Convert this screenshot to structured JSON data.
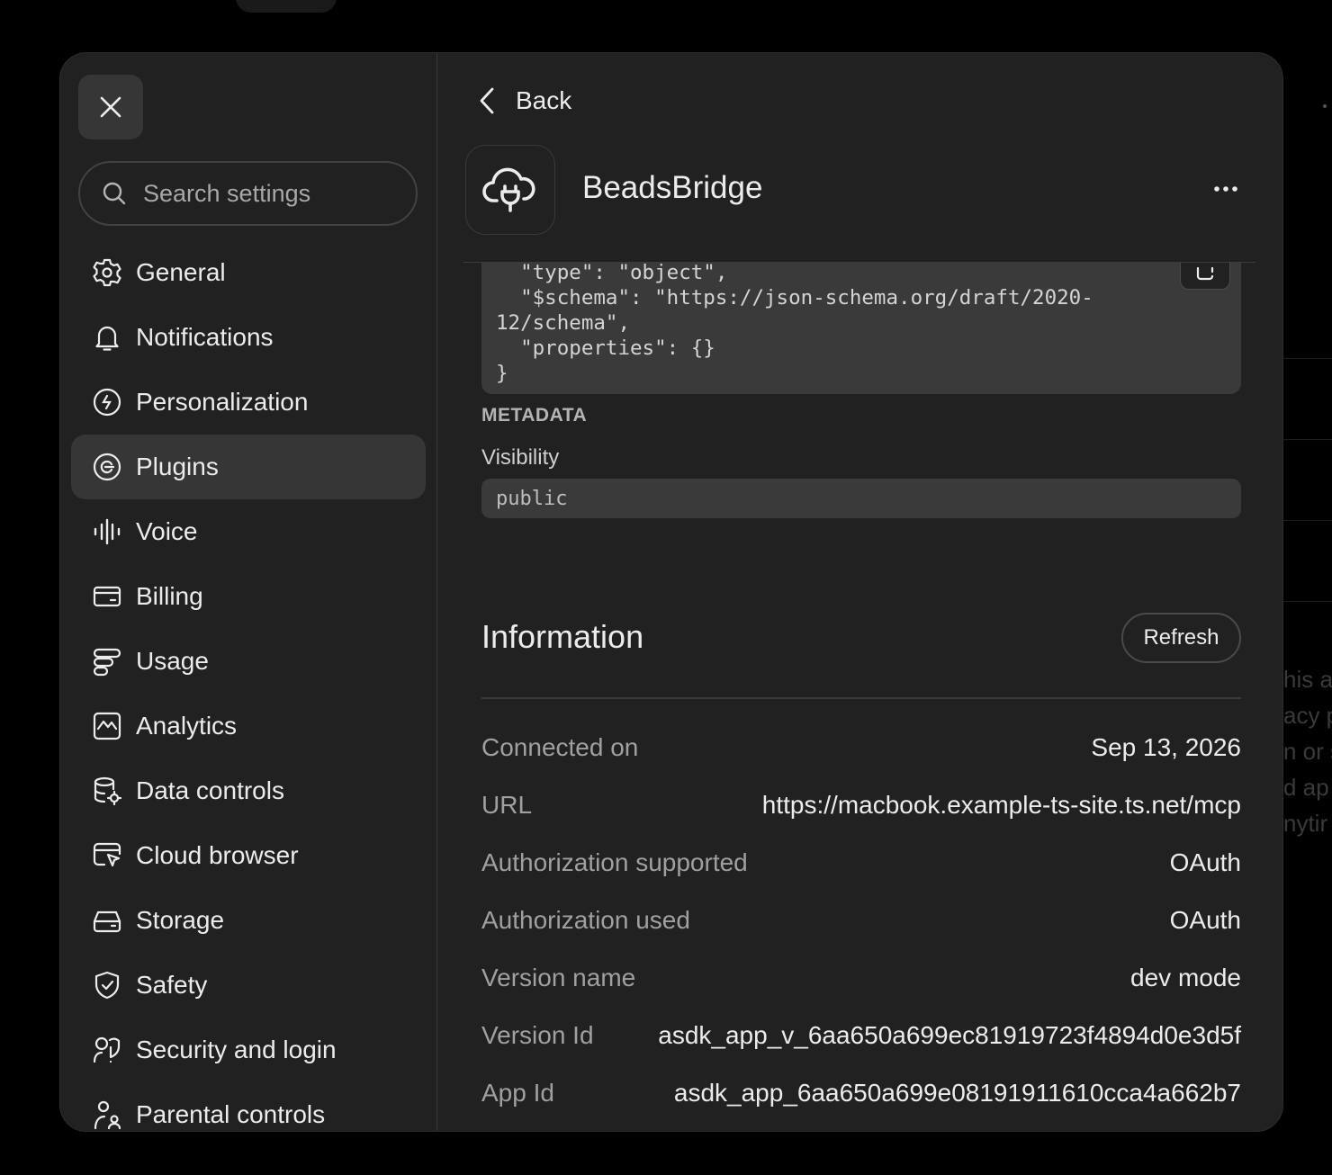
{
  "search": {
    "placeholder": "Search settings"
  },
  "sidebar": {
    "items": [
      {
        "label": "General",
        "icon": "gear-icon"
      },
      {
        "label": "Notifications",
        "icon": "bell-icon"
      },
      {
        "label": "Personalization",
        "icon": "personalization-icon"
      },
      {
        "label": "Plugins",
        "icon": "plugins-icon",
        "active": true
      },
      {
        "label": "Voice",
        "icon": "voice-icon"
      },
      {
        "label": "Billing",
        "icon": "credit-card-icon"
      },
      {
        "label": "Usage",
        "icon": "usage-icon"
      },
      {
        "label": "Analytics",
        "icon": "analytics-icon"
      },
      {
        "label": "Data controls",
        "icon": "database-icon"
      },
      {
        "label": "Cloud browser",
        "icon": "cloud-browser-icon"
      },
      {
        "label": "Storage",
        "icon": "storage-icon"
      },
      {
        "label": "Safety",
        "icon": "shield-check-icon"
      },
      {
        "label": "Security and login",
        "icon": "security-icon"
      },
      {
        "label": "Parental controls",
        "icon": "parental-icon"
      }
    ]
  },
  "header": {
    "back_label": "Back",
    "app_name": "BeadsBridge",
    "app_icon": "cloud-plug-icon"
  },
  "schema_code": "  \"type\": \"object\",\n  \"$schema\": \"https://json-schema.org/draft/2020-\n12/schema\",\n  \"properties\": {}\n}",
  "metadata": {
    "title": "METADATA",
    "visibility_label": "Visibility",
    "visibility_value": "public"
  },
  "information": {
    "title": "Information",
    "refresh_label": "Refresh",
    "rows": [
      {
        "key": "Connected on",
        "value": "Sep 13, 2026"
      },
      {
        "key": "URL",
        "value": "https://macbook.example-ts-site.ts.net/mcp"
      },
      {
        "key": "Authorization supported",
        "value": "OAuth"
      },
      {
        "key": "Authorization used",
        "value": "OAuth"
      },
      {
        "key": "Version name",
        "value": "dev mode"
      },
      {
        "key": "Version Id",
        "value": "asdk_app_v_6aa650a699ec81919723f4894d0e3d5f"
      },
      {
        "key": "App Id",
        "value": "asdk_app_6aa650a699e08191911610cca4a662b7"
      }
    ]
  },
  "background": {
    "snippets": [
      "his a",
      "acy p",
      "n or s",
      "d ap",
      "nytir"
    ]
  }
}
